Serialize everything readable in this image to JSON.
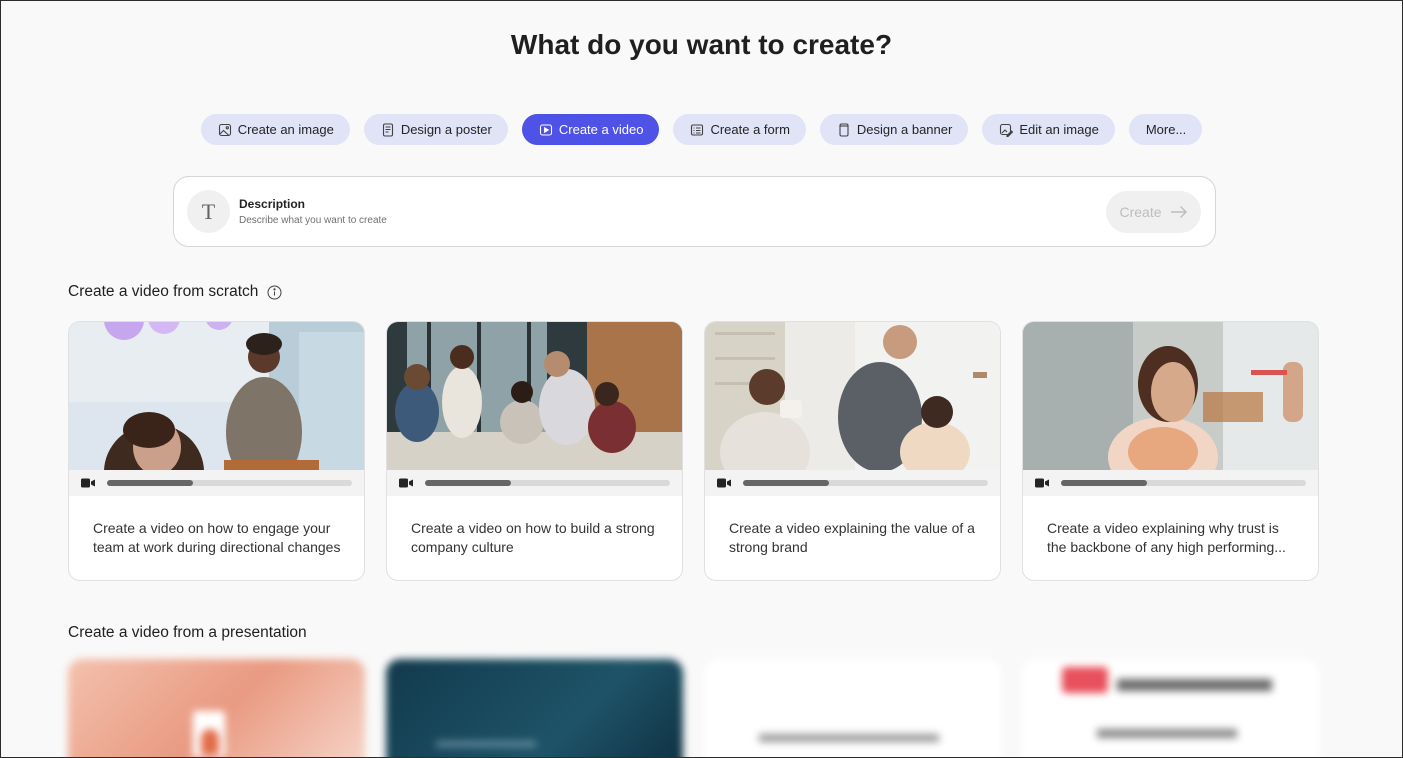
{
  "page": {
    "title": "What do you want to create?"
  },
  "chips": [
    {
      "label": "Create an image",
      "icon": "image-icon",
      "active": false
    },
    {
      "label": "Design a poster",
      "icon": "poster-icon",
      "active": false
    },
    {
      "label": "Create a video",
      "icon": "video-icon",
      "active": true
    },
    {
      "label": "Create a form",
      "icon": "form-icon",
      "active": false
    },
    {
      "label": "Design a banner",
      "icon": "banner-icon",
      "active": false
    },
    {
      "label": "Edit an image",
      "icon": "edit-image-icon",
      "active": false
    },
    {
      "label": "More...",
      "icon": "",
      "active": false
    }
  ],
  "prompt": {
    "label": "Description",
    "placeholder": "Describe what you want to create",
    "icon_glyph": "T",
    "create_label": "Create"
  },
  "sections": {
    "scratch_title": "Create a video from scratch",
    "presentation_title": "Create a video from a presentation"
  },
  "cards": [
    {
      "text": "Create a video on how to engage your team at work during directional changes",
      "progress": 0.35
    },
    {
      "text": "Create a video on how to build a strong company culture",
      "progress": 0.35
    },
    {
      "text": "Create a video explaining the value of a strong brand",
      "progress": 0.35
    },
    {
      "text": "Create a video explaining why trust is the backbone of any high performing...",
      "progress": 0.35
    }
  ],
  "colors": {
    "accent": "#4f52e6",
    "chip_bg": "#e1e3f7"
  }
}
